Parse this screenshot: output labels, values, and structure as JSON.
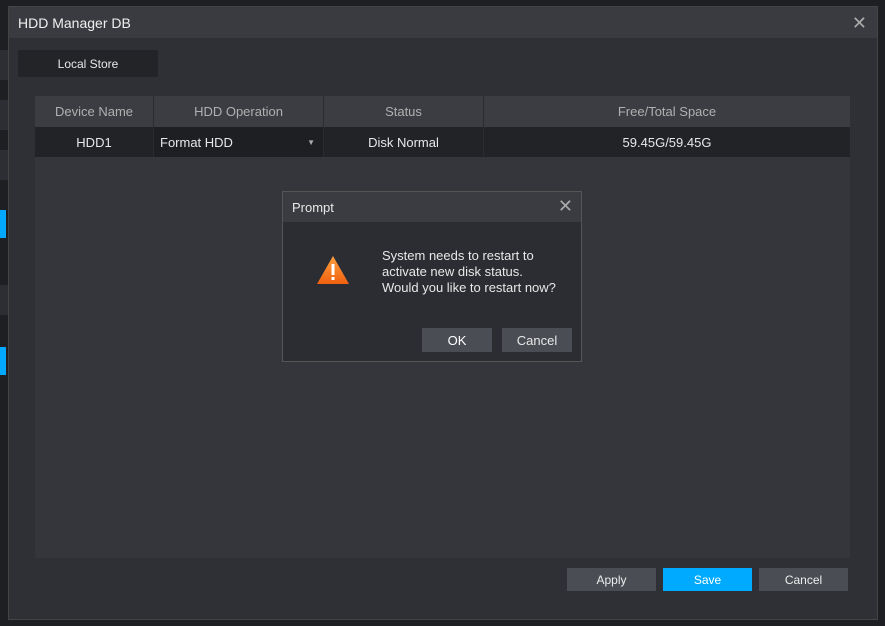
{
  "window": {
    "title": "HDD Manager DB"
  },
  "tabs": [
    {
      "label": "Local Store"
    }
  ],
  "table": {
    "headers": [
      "Device Name",
      "HDD Operation",
      "Status",
      "Free/Total Space"
    ],
    "rows": [
      {
        "device": "HDD1",
        "operation": "Format HDD",
        "status": "Disk Normal",
        "space": "59.45G/59.45G"
      }
    ]
  },
  "buttons": {
    "apply": "Apply",
    "save": "Save",
    "cancel": "Cancel"
  },
  "prompt": {
    "title": "Prompt",
    "lines": [
      "System needs to restart to",
      "activate new disk status.",
      "Would you like to restart now?"
    ],
    "ok": "OK",
    "cancel": "Cancel"
  },
  "colors": {
    "accent": "#00aaff",
    "warning": "#ff7a1a"
  }
}
